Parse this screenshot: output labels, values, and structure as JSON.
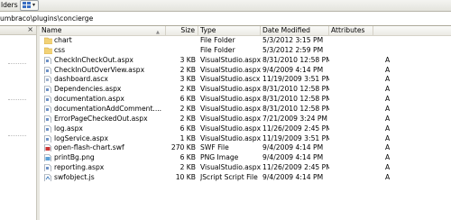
{
  "toolbar": {
    "folders_label": "lders"
  },
  "address": {
    "path": "umbraco\\plugins\\concierge"
  },
  "columns": {
    "name": "Name",
    "size": "Size",
    "type": "Type",
    "date": "Date Modified",
    "attributes": "Attributes"
  },
  "files": [
    {
      "name": "chart",
      "size": "",
      "type": "File Folder",
      "date": "5/3/2012 3:15 PM",
      "attr": "",
      "icon": "folder-icon"
    },
    {
      "name": "css",
      "size": "",
      "type": "File Folder",
      "date": "5/3/2012 2:59 PM",
      "attr": "",
      "icon": "folder-icon"
    },
    {
      "name": "CheckInCheckOut.aspx",
      "size": "3 KB",
      "type": "VisualStudio.aspx.8.0",
      "date": "8/31/2010 12:58 PM",
      "attr": "A",
      "icon": "aspx-file-icon"
    },
    {
      "name": "CheckInOutOverView.aspx",
      "size": "2 KB",
      "type": "VisualStudio.aspx.8.0",
      "date": "9/4/2009 4:14 PM",
      "attr": "A",
      "icon": "aspx-file-icon"
    },
    {
      "name": "dashboard.ascx",
      "size": "3 KB",
      "type": "VisualStudio.ascx.8.0",
      "date": "11/19/2009 3:51 PM",
      "attr": "A",
      "icon": "ascx-file-icon"
    },
    {
      "name": "Dependencies.aspx",
      "size": "2 KB",
      "type": "VisualStudio.aspx.8.0",
      "date": "8/31/2010 12:58 PM",
      "attr": "A",
      "icon": "aspx-file-icon"
    },
    {
      "name": "documentation.aspx",
      "size": "6 KB",
      "type": "VisualStudio.aspx.8.0",
      "date": "8/31/2010 12:58 PM",
      "attr": "A",
      "icon": "aspx-file-icon"
    },
    {
      "name": "documentationAddComment....",
      "size": "2 KB",
      "type": "VisualStudio.aspx.8.0",
      "date": "8/31/2010 12:58 PM",
      "attr": "A",
      "icon": "aspx-file-icon"
    },
    {
      "name": "ErrorPageCheckedOut.aspx",
      "size": "2 KB",
      "type": "VisualStudio.aspx.8.0",
      "date": "7/21/2009 3:24 PM",
      "attr": "A",
      "icon": "aspx-file-icon"
    },
    {
      "name": "log.aspx",
      "size": "6 KB",
      "type": "VisualStudio.aspx.8.0",
      "date": "11/26/2009 2:45 PM",
      "attr": "A",
      "icon": "aspx-file-icon"
    },
    {
      "name": "logService.aspx",
      "size": "1 KB",
      "type": "VisualStudio.aspx.8.0",
      "date": "11/19/2009 3:51 PM",
      "attr": "A",
      "icon": "aspx-file-icon"
    },
    {
      "name": "open-flash-chart.swf",
      "size": "270 KB",
      "type": "SWF File",
      "date": "9/4/2009 4:14 PM",
      "attr": "A",
      "icon": "swf-file-icon"
    },
    {
      "name": "printBg.png",
      "size": "6 KB",
      "type": "PNG Image",
      "date": "9/4/2009 4:14 PM",
      "attr": "A",
      "icon": "png-image-icon"
    },
    {
      "name": "reporting.aspx",
      "size": "2 KB",
      "type": "VisualStudio.aspx.8.0",
      "date": "11/26/2009 2:45 PM",
      "attr": "A",
      "icon": "aspx-file-icon"
    },
    {
      "name": "swfobject.js",
      "size": "10 KB",
      "type": "JScript Script File",
      "date": "9/4/2009 4:14 PM",
      "attr": "A",
      "icon": "js-file-icon"
    }
  ]
}
